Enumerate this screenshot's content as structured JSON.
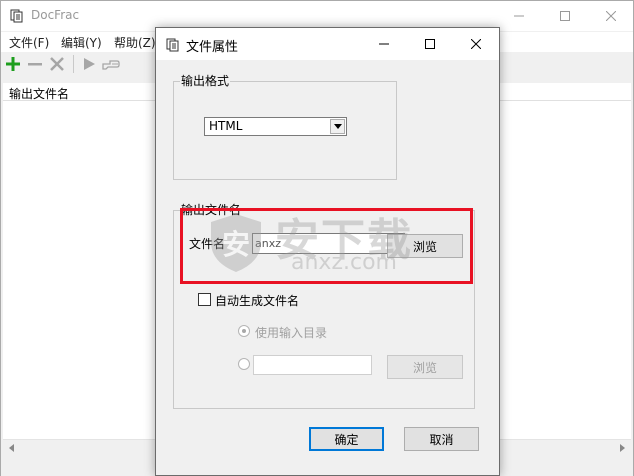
{
  "main_window": {
    "title": "DocFrac",
    "menu": [
      "文件(F)",
      "编辑(Y)",
      "帮助(Z)"
    ],
    "list_header": "输出文件名"
  },
  "dialog": {
    "title": "文件属性",
    "output_format": {
      "legend": "输出格式",
      "selected": "HTML"
    },
    "output_filename": {
      "legend": "输出文件名",
      "file_label": "文件名",
      "file_value": "anxz",
      "browse_label": "浏览",
      "auto_checkbox_label": "自动生成文件名",
      "use_input_dir_label": "使用输入目录",
      "custom_dir_value": "",
      "browse2_label": "浏览"
    },
    "ok_label": "确定",
    "cancel_label": "取消"
  },
  "watermark": {
    "cn": "安下载",
    "en": "anxz.com",
    "shield_text": "安"
  },
  "colors": {
    "highlight": "#e81123",
    "add_icon": "#1e9e1e",
    "disabled_text": "#a0a0a0",
    "default_button_border": "#0078d7"
  }
}
